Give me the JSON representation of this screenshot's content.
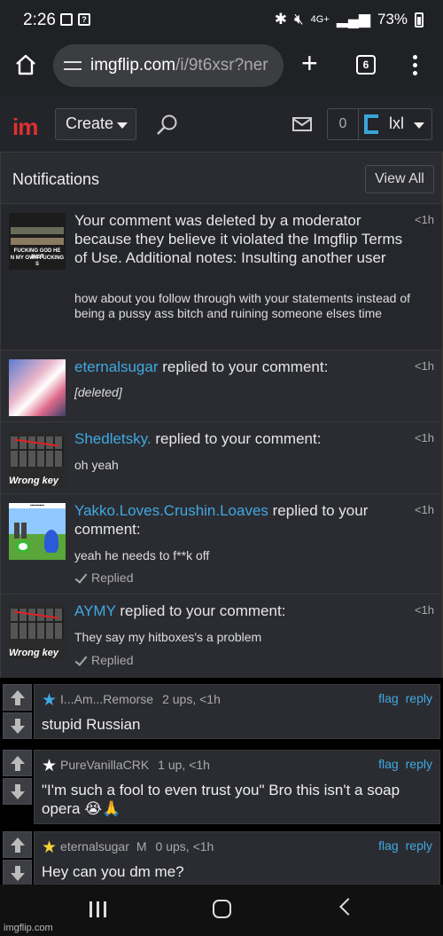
{
  "status_bar": {
    "time": "2:26",
    "icons": [
      "image-icon",
      "question-icon",
      "bluetooth-icon",
      "mute-icon",
      "4g-lte-icon",
      "signal-icon",
      "battery-icon"
    ],
    "network": "4G+",
    "battery": "73%"
  },
  "browser": {
    "url_host": "imgflip.com",
    "url_path": "/i/9t6xsr?ner",
    "tab_count": "6"
  },
  "site_header": {
    "logo": "im",
    "create_label": "Create",
    "notification_count": "0",
    "username": "lxl"
  },
  "notifications": {
    "title": "Notifications",
    "view_all_label": "View All",
    "items": [
      {
        "main_text": "Your comment was deleted by a moderator because they believe it violated the Imgflip Terms of Use. Additional notes: Insulting another user",
        "sub_text": "how about you follow through with your statements instead of being a pussy ass bitch and ruining someone elses time",
        "time": "<1h",
        "thumb_caption_1": "FUCKING GOD HE JUST",
        "thumb_caption_2": "N MY OWN FUCKING S"
      },
      {
        "username": "eternalsugar",
        "action": " replied to your comment:",
        "sub_text": "[deleted]",
        "time": "<1h"
      },
      {
        "username": "Shedletsky.",
        "action": " replied to your comment:",
        "sub_text": "oh yeah",
        "time": "<1h",
        "thumb_label": "Wrong key"
      },
      {
        "username": "Yakko.Loves.Crushin.Loaves",
        "action": " replied to your comment:",
        "sub_text": "yeah he needs to f**k off",
        "status": "Replied",
        "time": "<1h"
      },
      {
        "username": "AYMY",
        "action": " replied to your comment:",
        "sub_text": "They say my hitboxes's a problem",
        "status": "Replied",
        "time": "<1h",
        "thumb_label": "Wrong key"
      }
    ]
  },
  "comments": [
    {
      "username": "I...Am...Remorse",
      "star_color": "#3fa9e3",
      "ups": "2 ups, <1h",
      "text": "stupid Russian",
      "flag_label": "flag",
      "reply_label": "reply"
    },
    {
      "username": "PureVanillaCRK",
      "star_color": "#ffffff",
      "ups": "1 up, <1h",
      "text": "\"I'm such a fool to even trust you\" Bro this isn't a soap opera 😭🙏",
      "flag_label": "flag",
      "reply_label": "reply"
    },
    {
      "username": "eternalsugar",
      "star_color": "#f2d43a",
      "mod_badge": "M",
      "ups": "0 ups, <1h",
      "text": "Hey can you dm me?",
      "flag_label": "flag",
      "reply_label": "reply"
    }
  ],
  "watermark": "imgflip.com"
}
